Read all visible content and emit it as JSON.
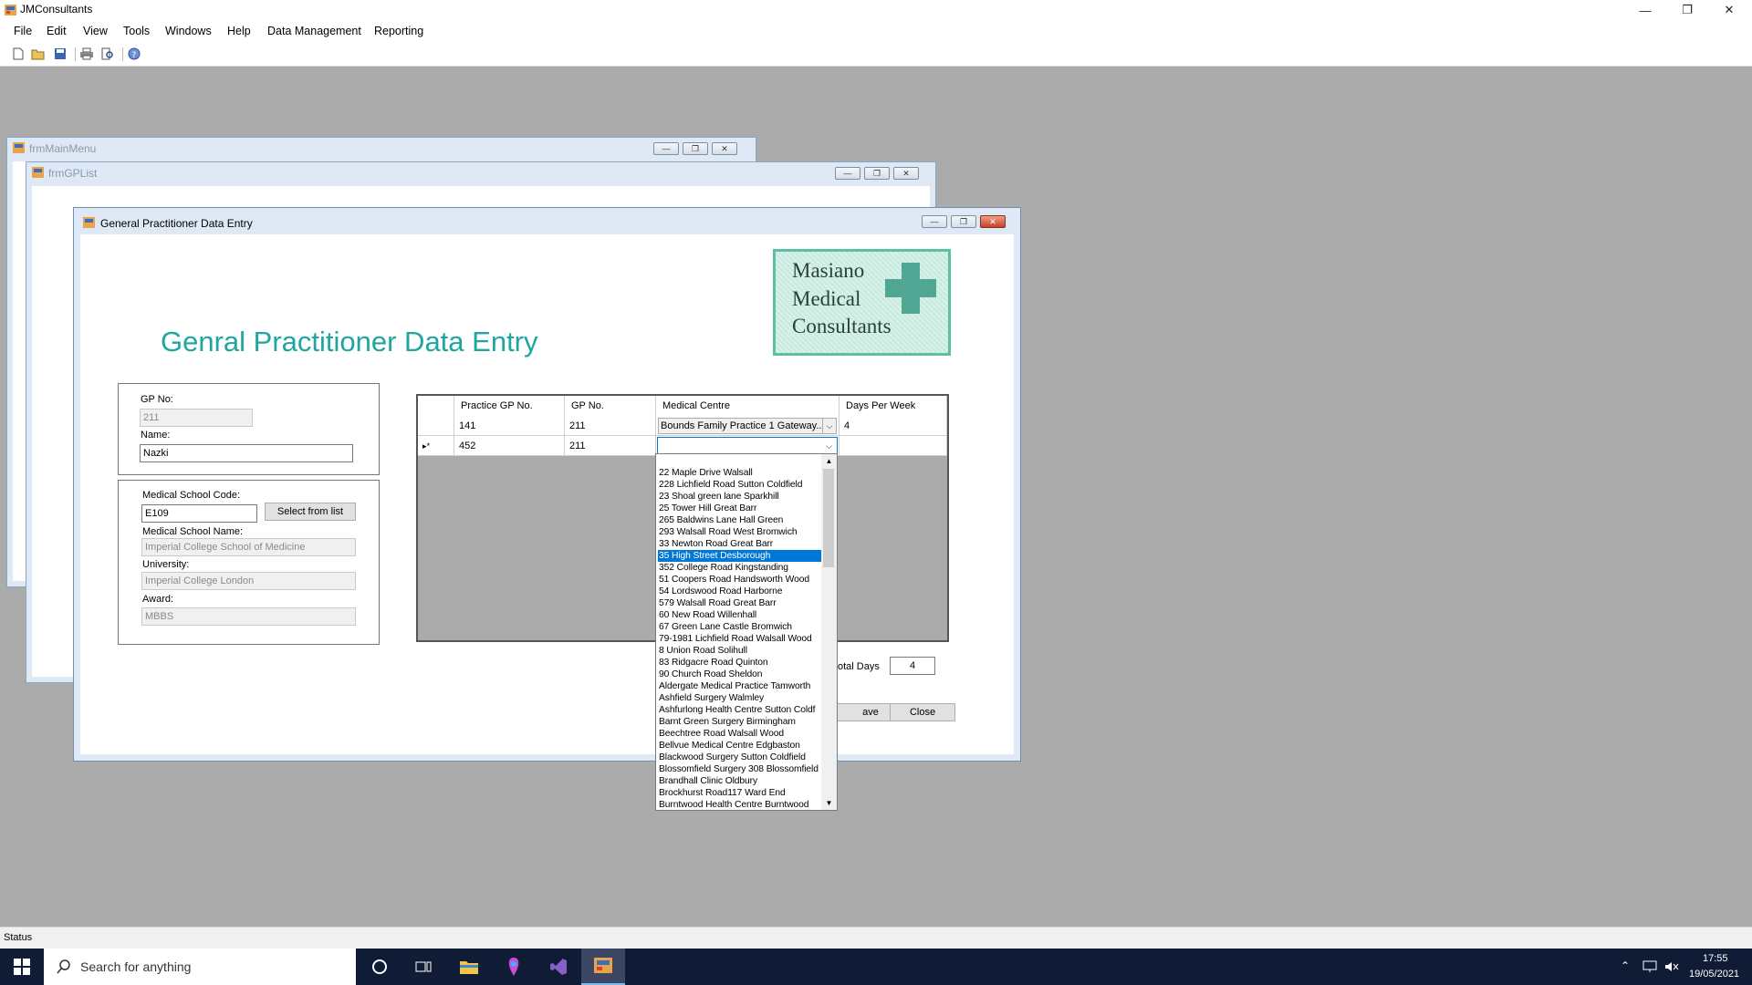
{
  "app": {
    "title": "JMConsultants",
    "caption": {
      "minimize": "—",
      "restore": "❐",
      "close": "✕"
    }
  },
  "menu": [
    "File",
    "Edit",
    "View",
    "Tools",
    "Windows",
    "Help",
    "Data Management",
    "Reporting"
  ],
  "toolbar": [
    "new-icon",
    "open-icon",
    "save-icon",
    "print-icon",
    "print-preview-icon",
    "help-icon"
  ],
  "windows": {
    "main_menu_title": "frmMainMenu",
    "gp_list_title": "frmGPList",
    "entry_title": "General Practitioner Data Entry"
  },
  "form": {
    "heading": "Genral Practitioner Data Entry",
    "logo": {
      "line1": "Masiano",
      "line2": "Medical",
      "line3": "Consultants"
    },
    "gp_no_label": "GP No:",
    "gp_no_value": "211",
    "name_label": "Name:",
    "name_value": "Nazki",
    "school_code_label": "Medical School Code:",
    "school_code_value": "E109",
    "select_button": "Select from list",
    "school_name_label": "Medical School Name:",
    "school_name_value": "Imperial College School of Medicine",
    "university_label": "University:",
    "university_value": "Imperial College London",
    "award_label": "Award:",
    "award_value": "MBBS",
    "total_days_label": "otal Days",
    "total_days_value": "4",
    "save_button": "ave",
    "close_button": "Close"
  },
  "grid": {
    "columns": [
      "Practice GP No.",
      "GP No.",
      "Medical Centre",
      "Days Per Week"
    ],
    "rows": [
      {
        "indicator": "",
        "practice_gp_no": "141",
        "gp_no": "211",
        "medical_centre": "Bounds Family Practice 1 Gateway...",
        "days": "4"
      },
      {
        "indicator": "▸*",
        "practice_gp_no": "452",
        "gp_no": "211",
        "medical_centre": "",
        "days": ""
      }
    ]
  },
  "dropdown": {
    "selected": "35 High Street Desborough",
    "items": [
      "22 Maple Drive Walsall",
      "228 Lichfield Road Sutton Coldfield",
      "23 Shoal green lane Sparkhill",
      "25 Tower Hill Great Barr",
      "265 Baldwins Lane Hall Green",
      "293 Walsall Road West Bromwich",
      "33 Newton Road Great Barr",
      "35 High Street Desborough",
      "352 College Road Kingstanding",
      "51 Coopers Road Handsworth Wood",
      "54 Lordswood Road Harborne",
      "579 Walsall Road Great Barr",
      "60 New Road Willenhall",
      "67 Green Lane Castle Bromwich",
      "79-1981 Lichfield Road Walsall Wood",
      "8 Union Road Solihull",
      "83 Ridgacre Road Quinton",
      "90 Church Road Sheldon",
      "Aldergate Medical Practice Tamworth",
      "Ashfield Surgery Walmley",
      "Ashfurlong Health Centre Sutton Coldf",
      "Barnt Green Surgery Birmingham",
      "Beechtree Road Walsall Wood",
      "Bellvue Medical Centre Edgbaston",
      "Blackwood Surgery Sutton Coldfield",
      "Blossomfield Surgery 308 Blossomfield",
      "Brandhall Clinic Oldbury",
      "Brockhurst Road117 Ward End",
      "Burntwood Health Centre Burntwood"
    ]
  },
  "status": {
    "text": "Status"
  },
  "taskbar": {
    "search_placeholder": "Search for anything",
    "time": "17:55",
    "date": "19/05/2021"
  },
  "colors": {
    "heading": "#1fa6a0",
    "selection": "#0078d7",
    "taskbar": "#101c35"
  }
}
